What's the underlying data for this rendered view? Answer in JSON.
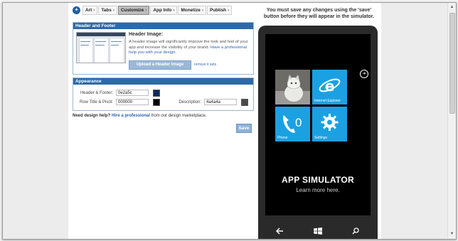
{
  "wizard": {
    "steps": [
      {
        "label": "Art"
      },
      {
        "label": "Tabs"
      },
      {
        "label": "Customize"
      },
      {
        "label": "App Info"
      },
      {
        "label": "Monetize"
      },
      {
        "label": "Publish"
      }
    ],
    "active_step": "Customize",
    "separator": ">"
  },
  "header_footer": {
    "section_title": "Header and Footer",
    "image_title": "Header Image:",
    "description": "A header image will significantly improve the look and feel of your app and increase the visibility of your brand.",
    "professional_link": "Have a professional help you with your design.",
    "upload_label": "Upload a Header Image",
    "remove_label": "remove it sets"
  },
  "appearance": {
    "section_title": "Appearance",
    "fields": [
      {
        "label": "Header & Footer:",
        "value": "0e2a5c",
        "color": "#0e2a5c"
      },
      {
        "label": "Row Title & Pivot:",
        "value": "000000",
        "color": "#000000"
      },
      {
        "label": "Description:",
        "value": "4a4a4a",
        "color": "#4a4a4a"
      }
    ]
  },
  "help": {
    "lead": "Need design help?",
    "link": "Hire a professional",
    "tail": "from our design marketplace."
  },
  "save_label": "Save",
  "notice": "You must save any changes using the 'save' button before they will appear in the simulator.",
  "simulator": {
    "tiles": [
      {
        "label": ""
      },
      {
        "label": "Internet Explorer"
      },
      {
        "label": "Phone",
        "count": "0"
      },
      {
        "label": "Settings"
      }
    ],
    "title": "APP SIMULATOR",
    "subtitle": "Learn more here.",
    "colors": {
      "tile": "#1ba1e2",
      "background": "#000000"
    }
  },
  "icons": [
    "wizard-logo-icon",
    "arrow-right-circle-icon",
    "internet-explorer-icon",
    "phone-icon",
    "settings-gear-icon",
    "back-arrow-icon",
    "windows-logo-icon",
    "search-icon"
  ]
}
